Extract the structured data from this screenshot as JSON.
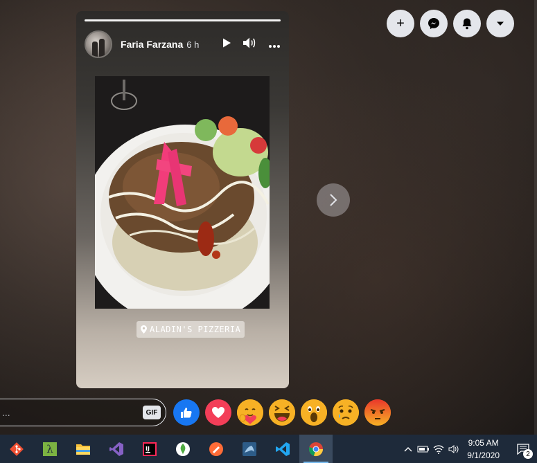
{
  "story": {
    "author": "Faria Farzana",
    "time": "6 h",
    "location": "ALADIN'S PIZZERIA",
    "icons": [
      "play-icon",
      "volume-icon",
      "more-icon"
    ]
  },
  "top_actions": [
    {
      "name": "create-button",
      "icon": "plus-icon",
      "glyph": "+"
    },
    {
      "name": "messenger-button",
      "icon": "messenger-icon",
      "glyph": "✆"
    },
    {
      "name": "notifications-button",
      "icon": "bell-icon",
      "glyph": "🔔"
    },
    {
      "name": "account-menu-button",
      "icon": "caret-down-icon",
      "glyph": "▾"
    }
  ],
  "reply": {
    "placeholder": "...",
    "gif_label": "GIF"
  },
  "reactions": [
    {
      "name": "like",
      "glyph": "👍",
      "color": "#1877f2"
    },
    {
      "name": "love",
      "glyph": "❤",
      "color": "#f33e58"
    },
    {
      "name": "care",
      "glyph": "🤗",
      "color": "#f7b125"
    },
    {
      "name": "haha",
      "glyph": "😆",
      "color": "#f7b125"
    },
    {
      "name": "wow",
      "glyph": "😮",
      "color": "#f7b125"
    },
    {
      "name": "sad",
      "glyph": "😢",
      "color": "#f7b125"
    },
    {
      "name": "angry",
      "glyph": "😡",
      "color": "#e9710f"
    }
  ],
  "taskbar": {
    "apps": [
      {
        "name": "git-app",
        "glyph": "◆",
        "color": "#f05033"
      },
      {
        "name": "lambda-app",
        "glyph": "λ",
        "color": "#7cb342"
      },
      {
        "name": "file-explorer-app",
        "glyph": "▬",
        "color": "#f8c13a"
      },
      {
        "name": "visual-studio-app",
        "glyph": "⋈",
        "color": "#8661c5"
      },
      {
        "name": "intellij-app",
        "glyph": "IJ",
        "color": "#fe2857"
      },
      {
        "name": "mongodb-app",
        "glyph": "❦",
        "color": "#4faa41"
      },
      {
        "name": "postman-app",
        "glyph": "✈",
        "color": "#ff6c37"
      },
      {
        "name": "mysql-workbench-app",
        "glyph": "◩",
        "color": "#4479a1"
      },
      {
        "name": "vscode-app",
        "glyph": "⋊",
        "color": "#22a7f2"
      },
      {
        "name": "chrome-app",
        "glyph": "◎",
        "color": "#4caf50",
        "active": true
      }
    ],
    "time": "9:05 AM",
    "date": "9/1/2020",
    "notification_count": "2"
  }
}
